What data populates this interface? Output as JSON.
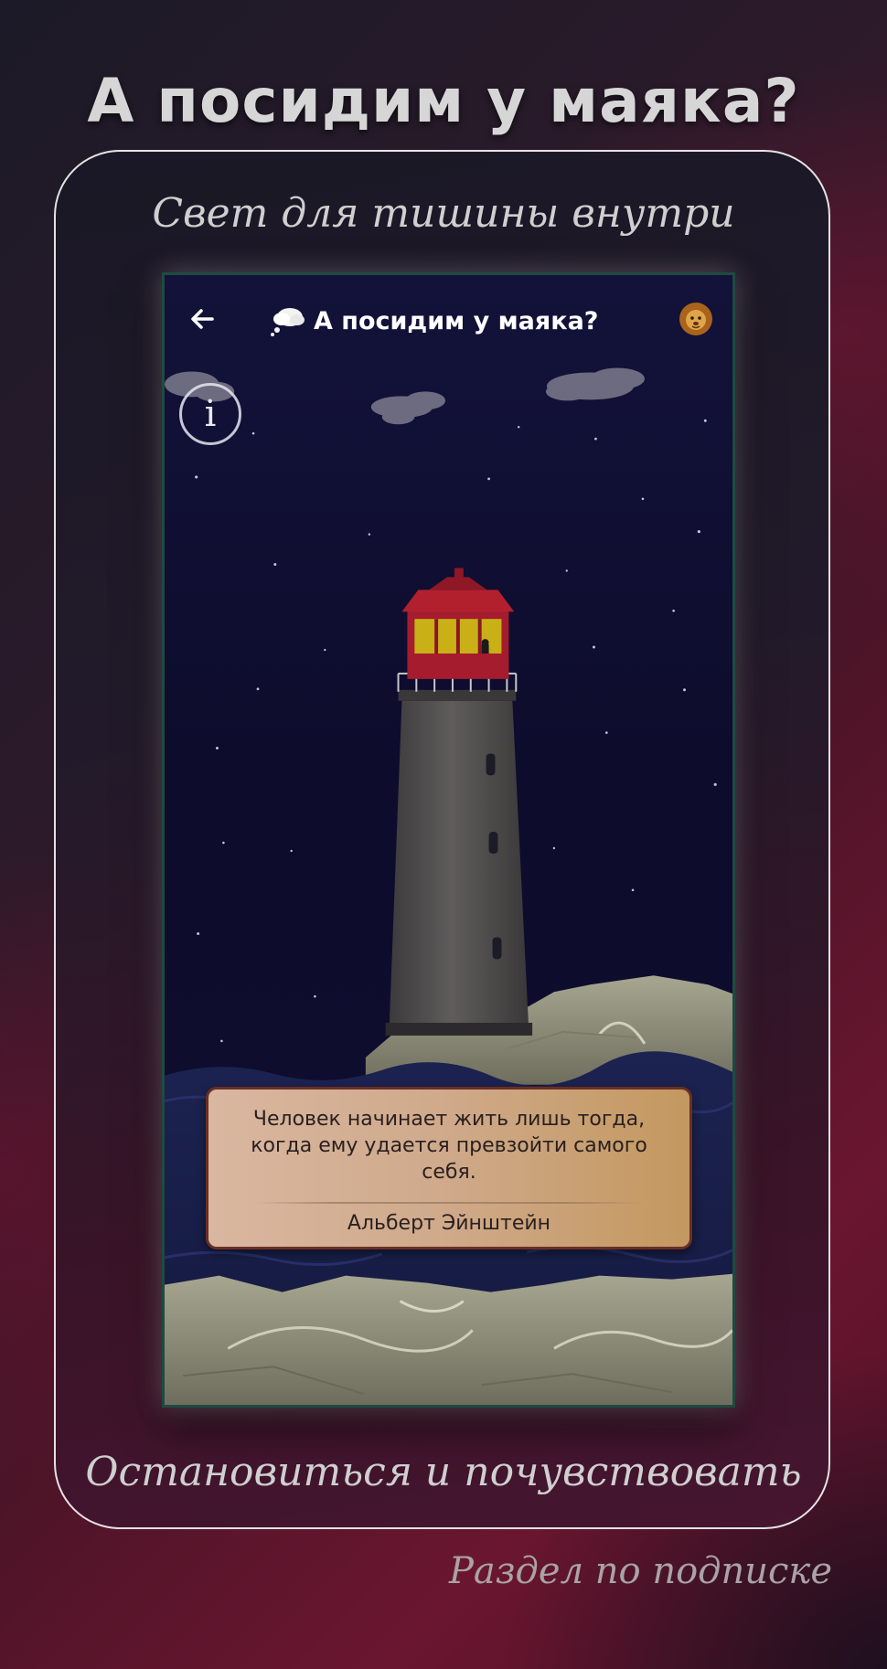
{
  "page_title": "А посидим у маяка?",
  "tagline_top": "Свет для тишины внутри",
  "tagline_bottom": "Остановиться и почувствовать",
  "subscription_note": "Раздел по подписке",
  "app": {
    "title": "А посидим у маяка?",
    "back_icon": "arrow-left-icon",
    "title_icon": "thought-bubble-icon",
    "avatar_icon": "lion-icon",
    "info_label": "i"
  },
  "quote": {
    "text": "Человек начинает жить лишь тогда, когда ему удается превзойти самого себя.",
    "author": "Альберт Эйнштейн"
  },
  "colors": {
    "screen_sky": "#0d0c2c",
    "lighthouse_top": "#a01c2c",
    "lighthouse_tower": "#5a5858",
    "lamp_window": "#c9b017",
    "card_left": "#d9b7a0",
    "card_right": "#c4985f",
    "frame_border": "#ffffff"
  }
}
